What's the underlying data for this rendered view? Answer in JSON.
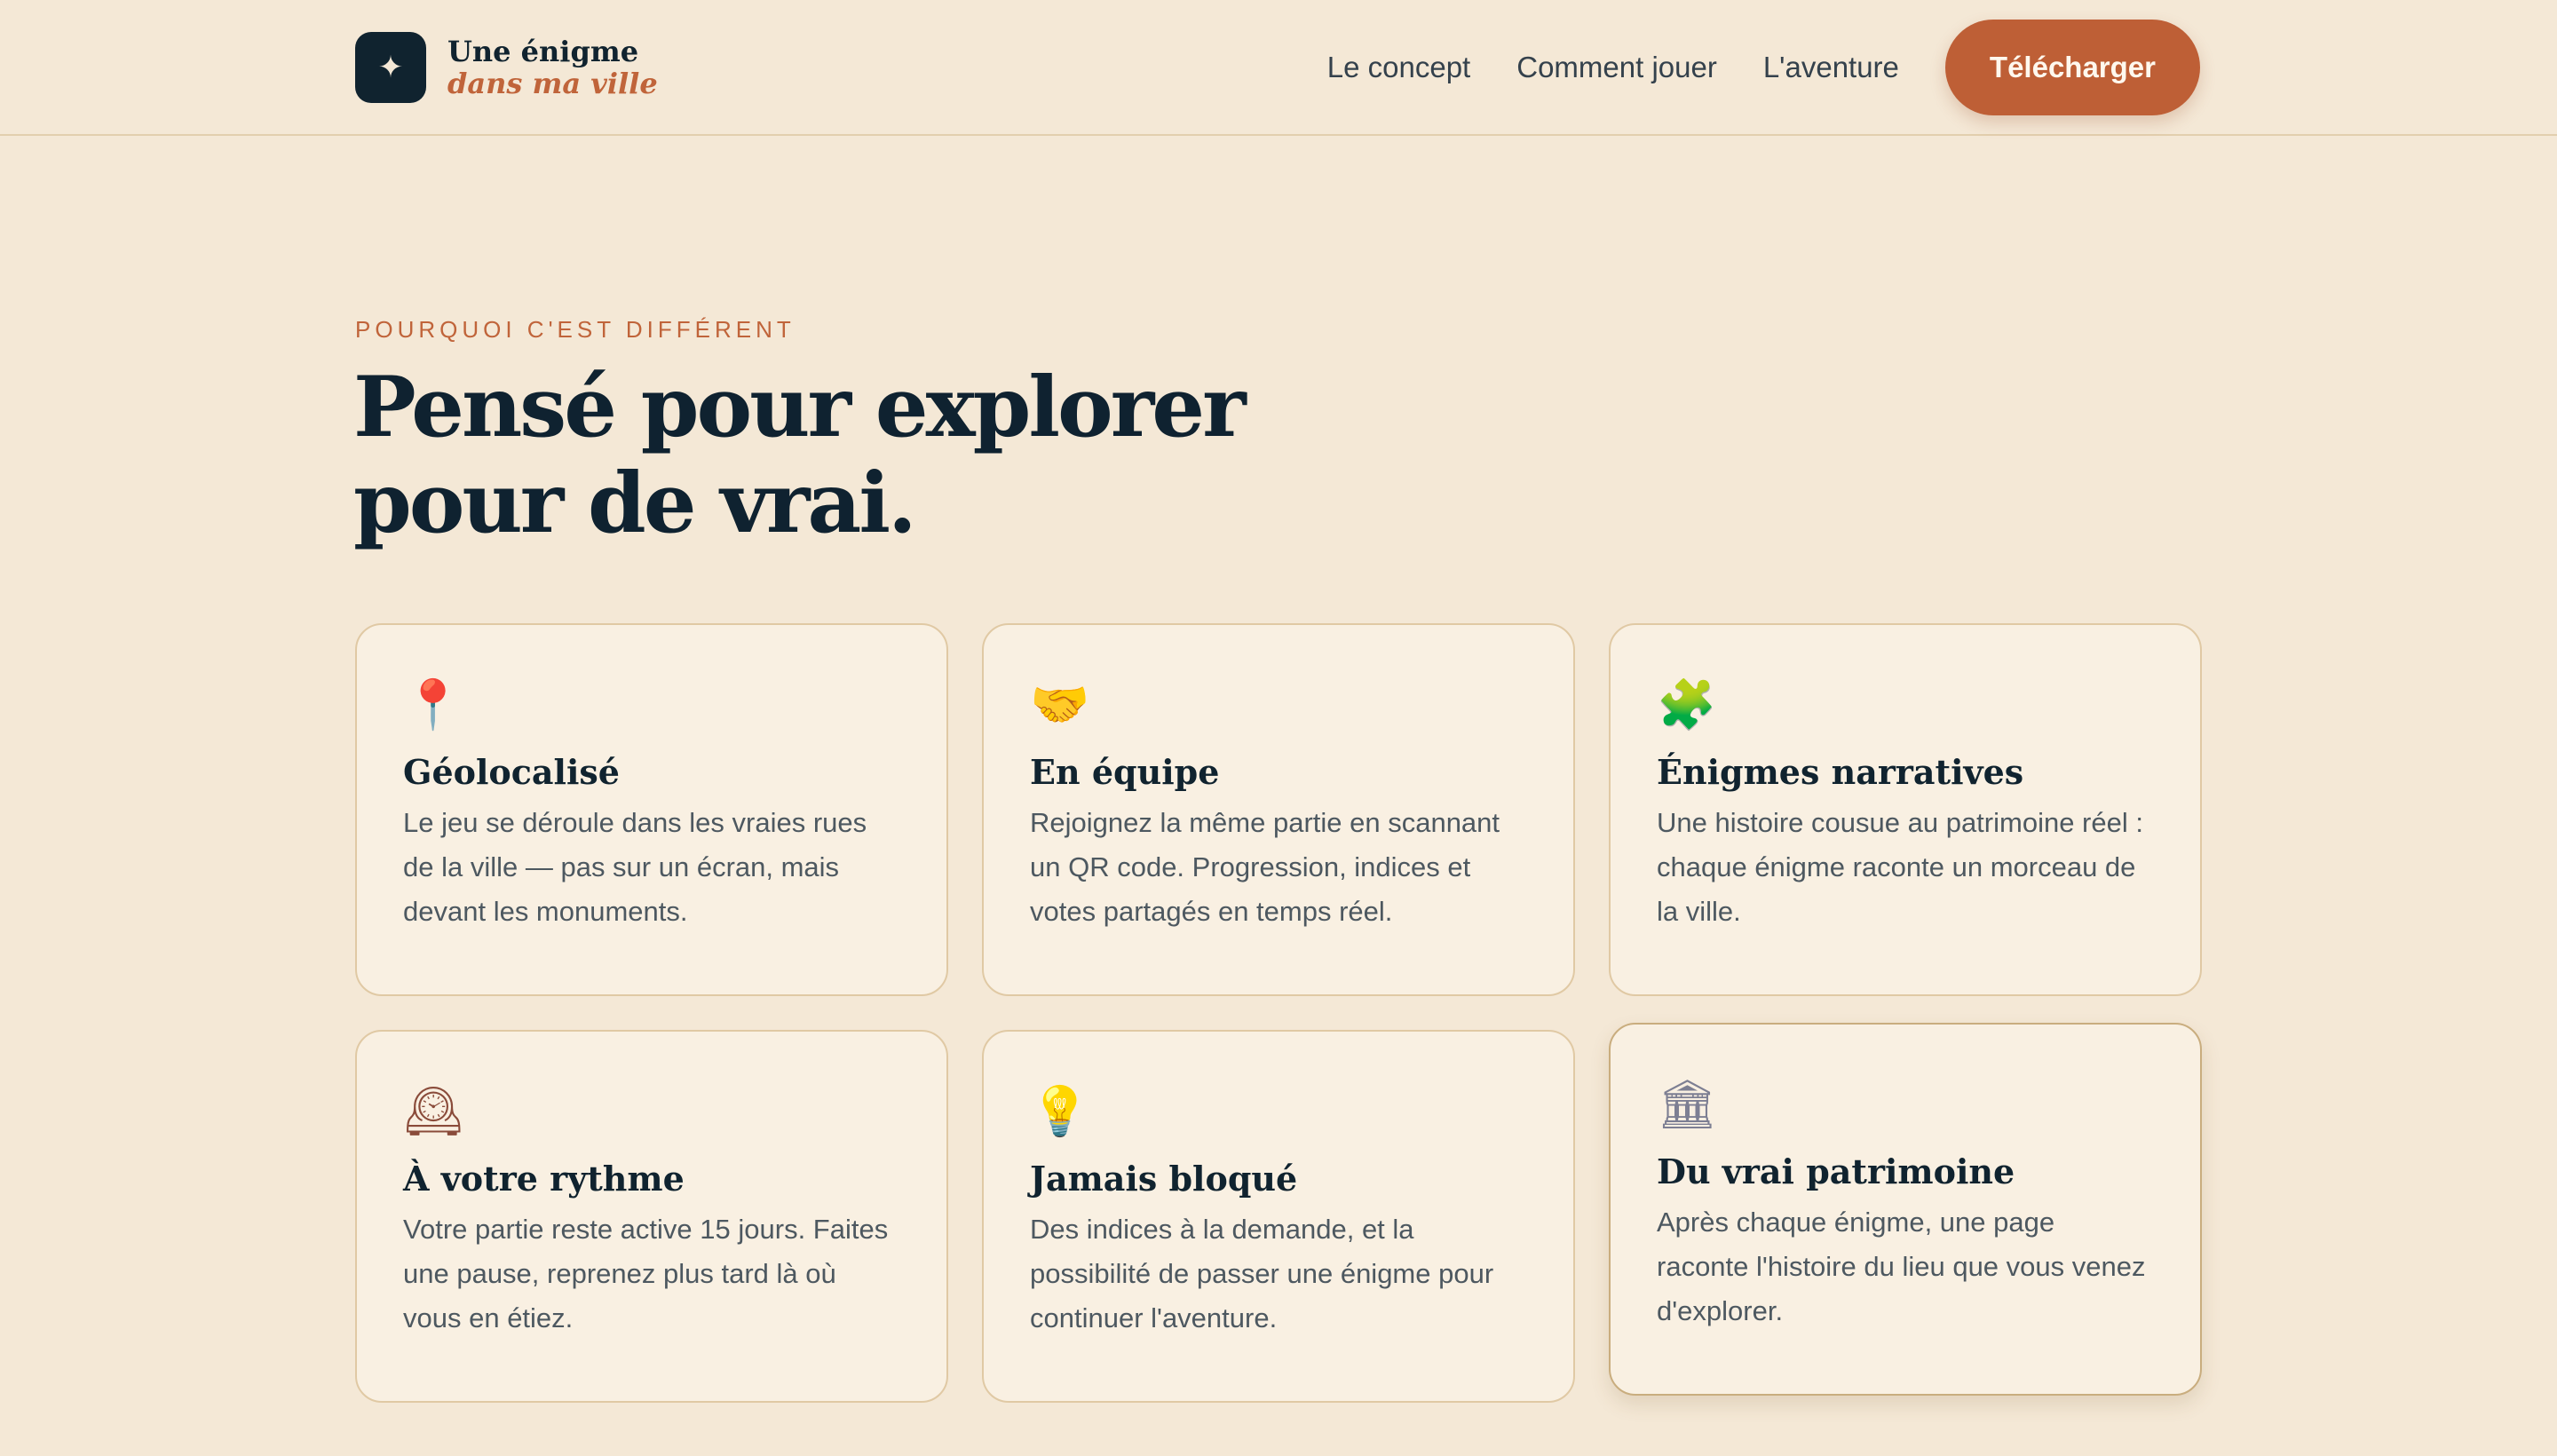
{
  "header": {
    "logo_mark": "✦",
    "logo_line1": "Une énigme",
    "logo_line2": "dans ma ville",
    "nav": [
      "Le concept",
      "Comment jouer",
      "L'aventure"
    ],
    "cta": "Télécharger"
  },
  "section": {
    "eyebrow": "POURQUOI C'EST DIFFÉRENT",
    "title_line1": "Pensé pour explorer",
    "title_line2": "pour de vrai."
  },
  "features": [
    {
      "icon": "📍",
      "icon_name": "pin-icon",
      "title": "Géolocalisé",
      "text": "Le jeu se déroule dans les vraies rues de la ville — pas sur un écran, mais devant les monuments."
    },
    {
      "icon": "🤝",
      "icon_name": "handshake-icon",
      "title": "En équipe",
      "text": "Rejoignez la même partie en scannant un QR code. Progression, indices et votes partagés en temps réel."
    },
    {
      "icon": "🧩",
      "icon_name": "puzzle-icon",
      "title": "Énigmes narratives",
      "text": "Une histoire cousue au patrimoine réel : chaque énigme raconte un morceau de la ville."
    },
    {
      "icon": "🕰",
      "icon_name": "clock-icon",
      "title": "À votre rythme",
      "text": "Votre partie reste active 15 jours. Faites une pause, reprenez plus tard là où vous en étiez."
    },
    {
      "icon": "💡",
      "icon_name": "bulb-icon",
      "title": "Jamais bloqué",
      "text": "Des indices à la demande, et la possibilité de passer une énigme pour continuer l'aventure."
    },
    {
      "icon": "🏛",
      "icon_name": "bank-icon",
      "title": "Du vrai patrimoine",
      "text": "Après chaque énigme, une page raconte l'histoire du lieu que vous venez d'explorer."
    }
  ],
  "colors": {
    "background": "#f4e8d6",
    "card": "#f9f0e2",
    "accent": "#be5f36",
    "navy": "#10232f"
  }
}
